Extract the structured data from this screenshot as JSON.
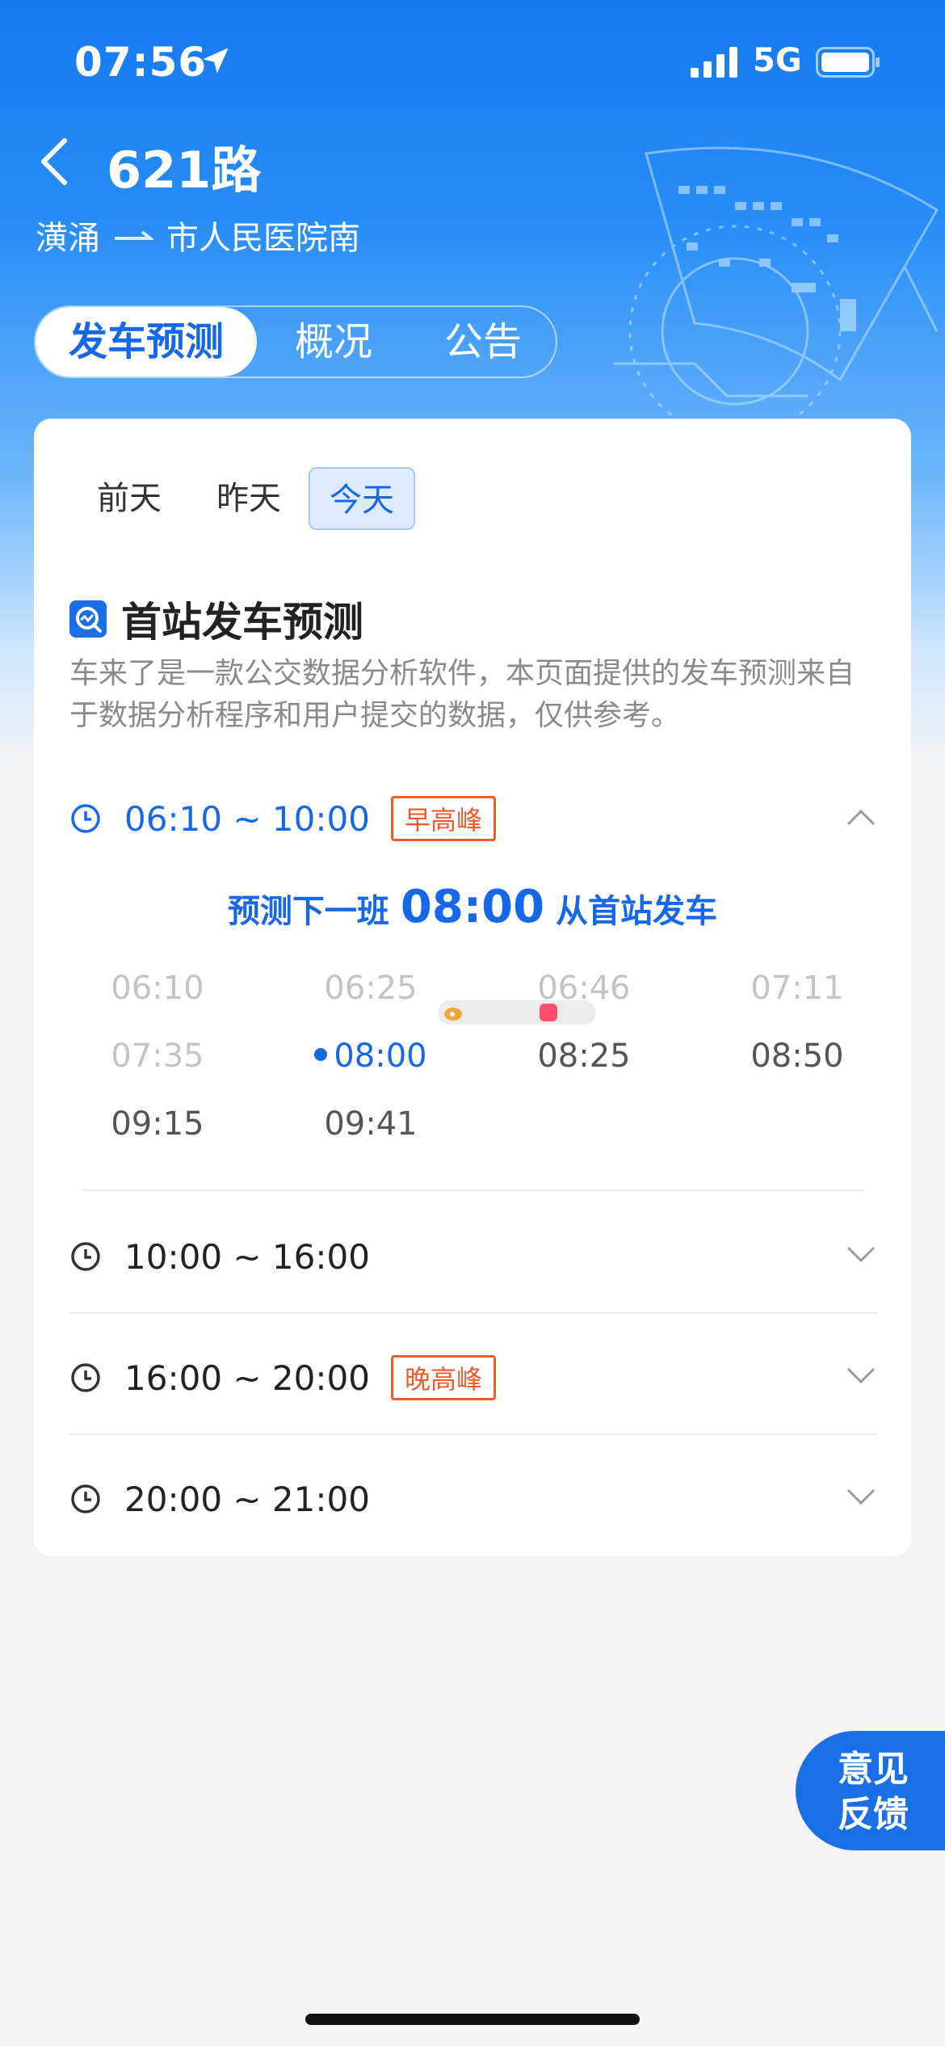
{
  "status_bar": {
    "time": "07:56",
    "network": "5G"
  },
  "header": {
    "title": "621路",
    "origin": "潢涌",
    "destination": "市人民医院南"
  },
  "tabs": [
    {
      "label": "发车预测",
      "active": true
    },
    {
      "label": "概况",
      "active": false
    },
    {
      "label": "公告",
      "active": false
    }
  ],
  "day_tabs": [
    {
      "label": "前天",
      "active": false
    },
    {
      "label": "昨天",
      "active": false
    },
    {
      "label": "今天",
      "active": true
    }
  ],
  "section": {
    "title": "首站发车预测",
    "description": "车来了是一款公交数据分析软件，本页面提供的发车预测来自于数据分析程序和用户提交的数据，仅供参考。"
  },
  "periods": [
    {
      "range": "06:10 ~ 10:00",
      "peak": "早高峰",
      "expanded": true
    },
    {
      "range": "10:00 ~ 16:00",
      "peak": "",
      "expanded": false
    },
    {
      "range": "16:00 ~ 20:00",
      "peak": "晚高峰",
      "expanded": false
    },
    {
      "range": "20:00 ~ 21:00",
      "peak": "",
      "expanded": false
    }
  ],
  "prediction": {
    "prefix": "预测下一班",
    "time": "08:00",
    "suffix": "从首站发车"
  },
  "departures": [
    {
      "time": "06:10",
      "state": "past"
    },
    {
      "time": "06:25",
      "state": "past"
    },
    {
      "time": "06:46",
      "state": "past"
    },
    {
      "time": "07:11",
      "state": "past"
    },
    {
      "time": "07:35",
      "state": "past"
    },
    {
      "time": "08:00",
      "state": "next"
    },
    {
      "time": "08:25",
      "state": "future"
    },
    {
      "time": "08:50",
      "state": "future"
    },
    {
      "time": "09:15",
      "state": "future"
    },
    {
      "time": "09:41",
      "state": "future"
    }
  ],
  "feedback": {
    "line1": "意见",
    "line2": "反馈"
  },
  "colors": {
    "accent": "#1668e8",
    "peak": "#ef5a2a",
    "hero_top": "#1479f0"
  }
}
